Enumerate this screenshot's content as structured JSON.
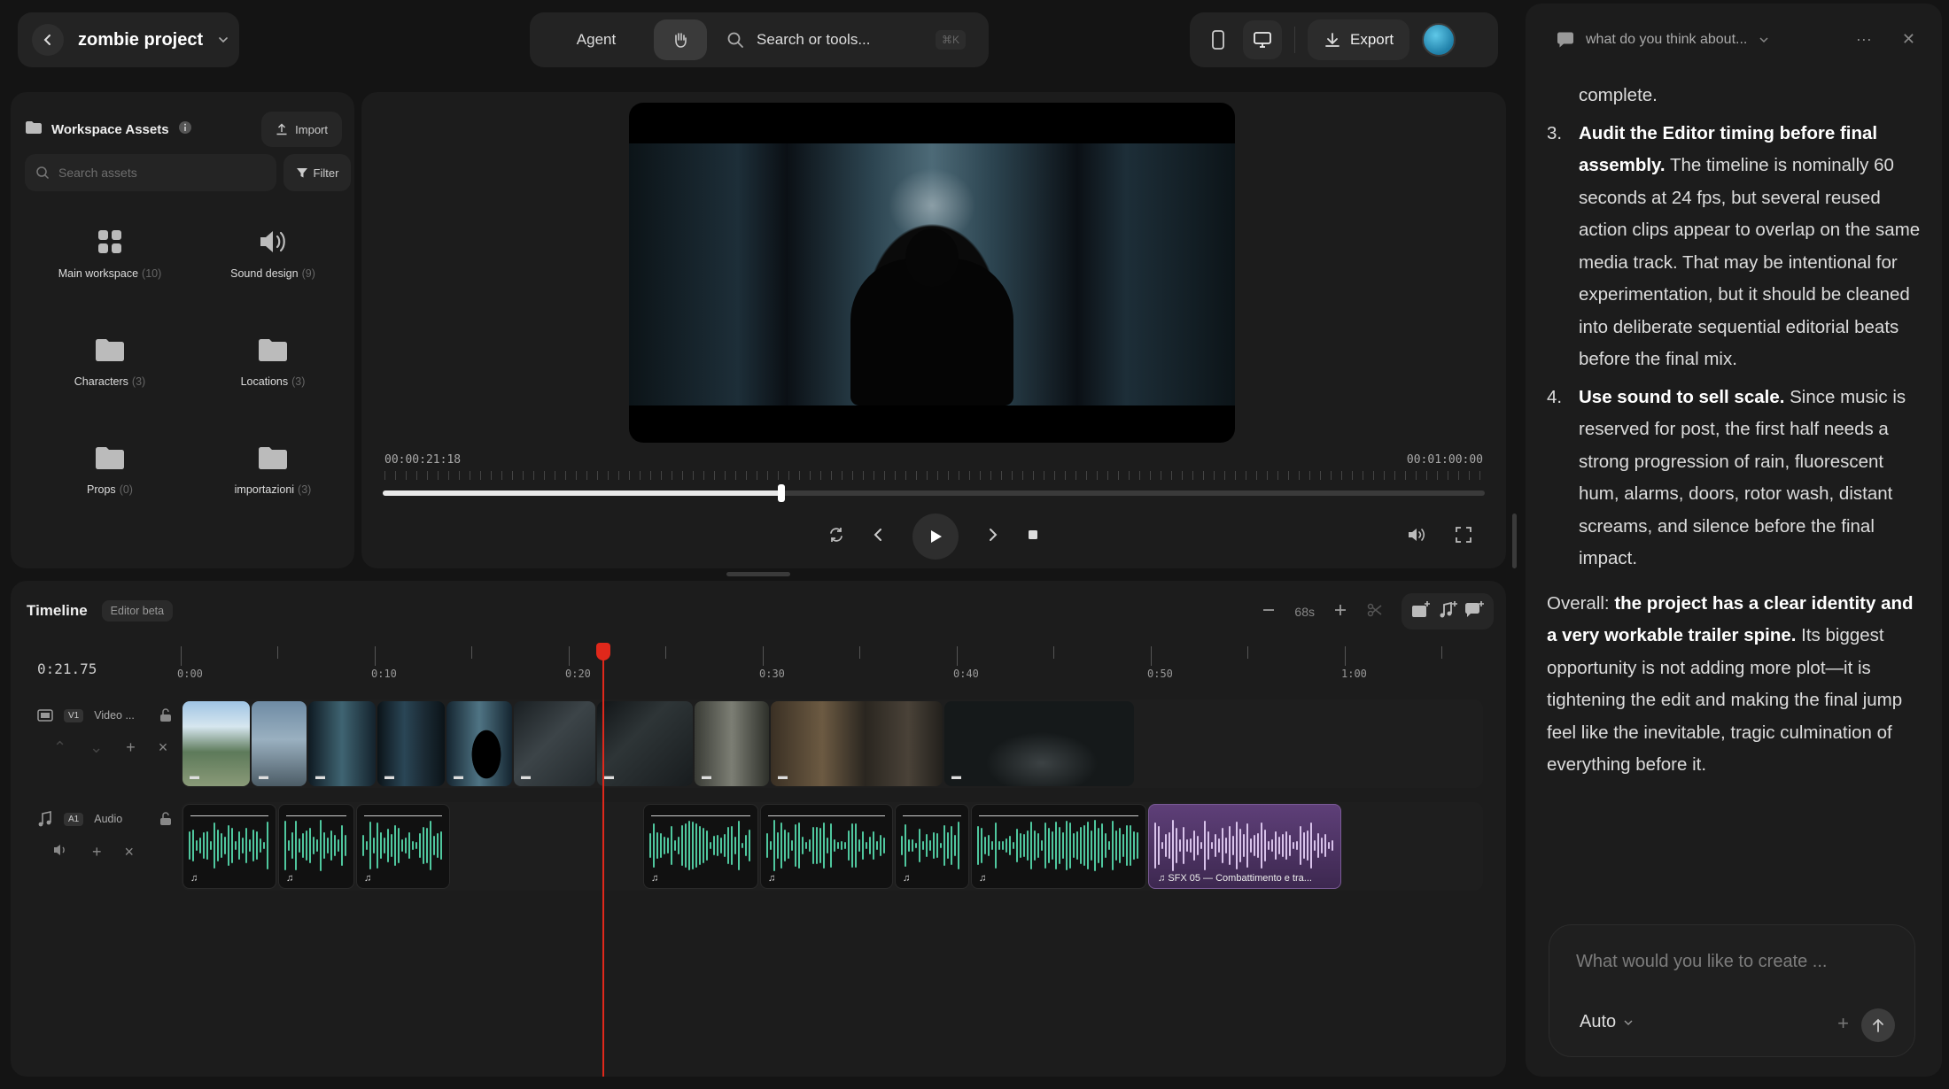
{
  "header": {
    "project_title": "zombie project",
    "agent_label": "Agent",
    "search_placeholder": "Search or tools...",
    "search_shortcut": "⌘K",
    "export_label": "Export"
  },
  "assets": {
    "title": "Workspace Assets",
    "import_label": "Import",
    "search_placeholder": "Search assets",
    "filter_label": "Filter",
    "folders": [
      {
        "name": "Main workspace",
        "count": "(10)",
        "icon": "grid-icon"
      },
      {
        "name": "Sound design",
        "count": "(9)",
        "icon": "speaker-icon"
      },
      {
        "name": "Characters",
        "count": "(3)",
        "icon": "folder-icon"
      },
      {
        "name": "Locations",
        "count": "(3)",
        "icon": "folder-icon"
      },
      {
        "name": "Props",
        "count": "(0)",
        "icon": "folder-icon"
      },
      {
        "name": "importazioni",
        "count": "(3)",
        "icon": "folder-icon"
      }
    ]
  },
  "preview": {
    "timecode_current": "00:00:21:18",
    "timecode_total": "00:01:00:00",
    "progress_fraction": 0.362
  },
  "timeline": {
    "title": "Timeline",
    "badge": "Editor beta",
    "zoom_label": "68s",
    "playhead_time": "0:21.75",
    "ruler_labels": [
      "0:00",
      "0:10",
      "0:20",
      "0:30",
      "0:40",
      "0:50",
      "1:00"
    ],
    "video_track": {
      "tag": "V1",
      "name": "Video ..."
    },
    "audio_track": {
      "tag": "A1",
      "name": "Audio"
    },
    "sfx_clip_label": "SFX 05 — Combattimento e tra..."
  },
  "chat": {
    "conversation_title": "what do you think about...",
    "intro_fragment": "complete.",
    "items": [
      {
        "num": "3.",
        "bold": "Audit the Editor timing before final assembly.",
        "text": " The timeline is nominally 60 seconds at 24 fps, but several reused action clips appear to overlap on the same media track. That may be intentional for experimentation, but it should be cleaned into deliberate sequential editorial beats before the final mix."
      },
      {
        "num": "4.",
        "bold": "Use sound to sell scale.",
        "text": " Since music is reserved for post, the first half needs a strong progression of rain, fluorescent hum, alarms, doors, rotor wash, distant screams, and silence before the final impact."
      }
    ],
    "overall_label": "Overall: ",
    "overall_bold": "the project has a clear identity and a very workable trailer spine.",
    "overall_text": " Its biggest opportunity is not adding more plot—it is tightening the edit and making the final jump feel like the inevitable, tragic culmination of everything before it.",
    "composer_placeholder": "What would you like to create ...",
    "mode_label": "Auto"
  },
  "colors": {
    "accent_playhead": "#e0281b",
    "waveform": "#4fc79e",
    "sfx_clip": "#5e3f78"
  }
}
